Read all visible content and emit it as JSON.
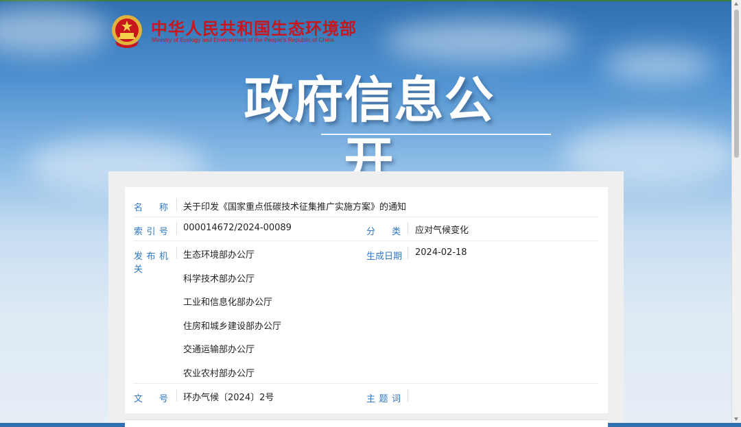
{
  "header": {
    "title_cn": "中华人民共和国生态环境部",
    "title_en": "Ministry of Ecology and Environment of the People's Republic of China",
    "banner": "政府信息公开"
  },
  "record": {
    "name": {
      "label": "名　称",
      "value": "关于印发《国家重点低碳技术征集推广实施方案》的通知"
    },
    "index": {
      "label": "索引号",
      "value": "000014672/2024-00089"
    },
    "category": {
      "label": "分　类",
      "value": "应对气候变化"
    },
    "issuer": {
      "label": "发布机关",
      "values": [
        "生态环境部办公厅",
        "科学技术部办公厅",
        "工业和信息化部办公厅",
        "住房和城乡建设部办公厅",
        "交通运输部办公厅",
        "农业农村部办公厅"
      ]
    },
    "date": {
      "label": "生成日期",
      "value": "2024-02-18"
    },
    "doc_no": {
      "label": "文　号",
      "value": "环办气候〔2024〕2号"
    },
    "keywords": {
      "label": "主题词",
      "value": ""
    }
  },
  "colors": {
    "accent_label": "#2f78c4",
    "title_red": "#c8161d"
  },
  "icons": {
    "emblem": "national-emblem-icon"
  }
}
